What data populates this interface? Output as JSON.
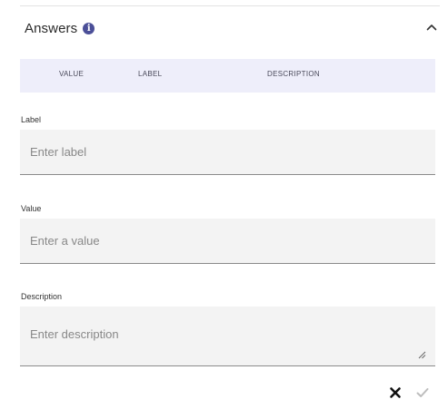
{
  "section": {
    "title": "Answers",
    "info_icon": "info-icon",
    "collapse_icon": "chevron-up-icon"
  },
  "table": {
    "columns": [
      "VALUE",
      "LABEL",
      "DESCRIPTION"
    ],
    "header_bg": "#eeeefa"
  },
  "form": {
    "label": {
      "label": "Label",
      "placeholder": "Enter label",
      "value": ""
    },
    "value": {
      "label": "Value",
      "placeholder": "Enter a value",
      "value": ""
    },
    "description": {
      "label": "Description",
      "placeholder": "Enter description",
      "value": ""
    }
  },
  "actions": {
    "cancel_icon": "close-icon",
    "confirm_icon": "check-icon",
    "confirm_disabled": true
  },
  "colors": {
    "accent": "#4b4f98",
    "input_bg": "#f3f3f3"
  }
}
